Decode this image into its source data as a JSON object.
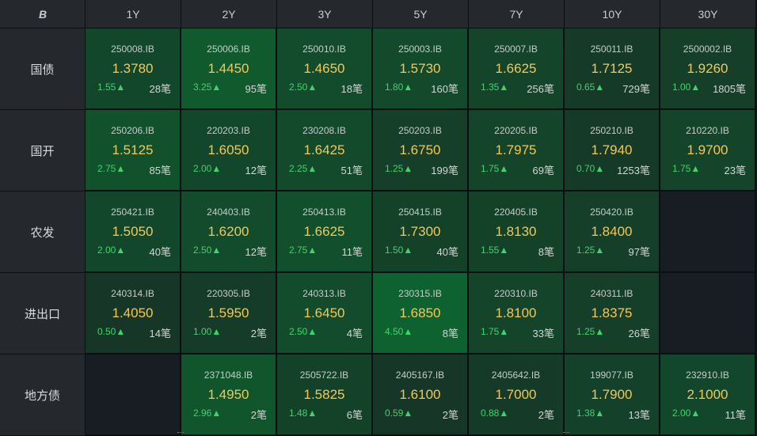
{
  "corner": {
    "icon": "logo-icon",
    "glyph": "B"
  },
  "tenors": [
    "1Y",
    "2Y",
    "3Y",
    "5Y",
    "7Y",
    "10Y",
    "30Y"
  ],
  "colors": {
    "rate": "#f2c85b",
    "change_up": "#3fd46a",
    "header_bg": "#25282d"
  },
  "rows": [
    {
      "label": "国债",
      "cells": [
        {
          "code": "250008.IB",
          "rate": "1.3780",
          "change": "1.55▲",
          "count": "28笔",
          "intensity": 0.5
        },
        {
          "code": "250006.IB",
          "rate": "1.4450",
          "change": "3.25▲",
          "count": "95笔",
          "intensity": 0.85
        },
        {
          "code": "250010.IB",
          "rate": "1.4650",
          "change": "2.50▲",
          "count": "18笔",
          "intensity": 0.6
        },
        {
          "code": "250003.IB",
          "rate": "1.5730",
          "change": "1.80▲",
          "count": "160笔",
          "intensity": 0.55
        },
        {
          "code": "250007.IB",
          "rate": "1.6625",
          "change": "1.35▲",
          "count": "256笔",
          "intensity": 0.45
        },
        {
          "code": "250011.IB",
          "rate": "1.7125",
          "change": "0.65▲",
          "count": "729笔",
          "intensity": 0.25
        },
        {
          "code": "2500002.IB",
          "rate": "1.9260",
          "change": "1.00▲",
          "count": "1805笔",
          "intensity": 0.35
        }
      ]
    },
    {
      "label": "国开",
      "cells": [
        {
          "code": "250206.IB",
          "rate": "1.5125",
          "change": "2.75▲",
          "count": "85笔",
          "intensity": 0.7
        },
        {
          "code": "220203.IB",
          "rate": "1.6050",
          "change": "2.00▲",
          "count": "12笔",
          "intensity": 0.5
        },
        {
          "code": "230208.IB",
          "rate": "1.6425",
          "change": "2.25▲",
          "count": "51笔",
          "intensity": 0.55
        },
        {
          "code": "250203.IB",
          "rate": "1.6750",
          "change": "1.25▲",
          "count": "199笔",
          "intensity": 0.35
        },
        {
          "code": "220205.IB",
          "rate": "1.7975",
          "change": "1.75▲",
          "count": "69笔",
          "intensity": 0.45
        },
        {
          "code": "250210.IB",
          "rate": "1.7940",
          "change": "0.70▲",
          "count": "1253笔",
          "intensity": 0.25
        },
        {
          "code": "210220.IB",
          "rate": "1.9700",
          "change": "1.75▲",
          "count": "23笔",
          "intensity": 0.45
        }
      ]
    },
    {
      "label": "农发",
      "cells": [
        {
          "code": "250421.IB",
          "rate": "1.5050",
          "change": "2.00▲",
          "count": "40笔",
          "intensity": 0.5
        },
        {
          "code": "240403.IB",
          "rate": "1.6200",
          "change": "2.50▲",
          "count": "12笔",
          "intensity": 0.6
        },
        {
          "code": "250413.IB",
          "rate": "1.6625",
          "change": "2.75▲",
          "count": "11笔",
          "intensity": 0.65
        },
        {
          "code": "250415.IB",
          "rate": "1.7300",
          "change": "1.50▲",
          "count": "40笔",
          "intensity": 0.4
        },
        {
          "code": "220405.IB",
          "rate": "1.8130",
          "change": "1.55▲",
          "count": "8笔",
          "intensity": 0.4
        },
        {
          "code": "250420.IB",
          "rate": "1.8400",
          "change": "1.25▲",
          "count": "97笔",
          "intensity": 0.35
        },
        null
      ]
    },
    {
      "label": "进出口",
      "cells": [
        {
          "code": "240314.IB",
          "rate": "1.4050",
          "change": "0.50▲",
          "count": "14笔",
          "intensity": 0.2
        },
        {
          "code": "220305.IB",
          "rate": "1.5950",
          "change": "1.00▲",
          "count": "2笔",
          "intensity": 0.3
        },
        {
          "code": "240313.IB",
          "rate": "1.6450",
          "change": "2.50▲",
          "count": "4笔",
          "intensity": 0.6
        },
        {
          "code": "230315.IB",
          "rate": "1.6850",
          "change": "4.50▲",
          "count": "8笔",
          "intensity": 1.0
        },
        {
          "code": "220310.IB",
          "rate": "1.8100",
          "change": "1.75▲",
          "count": "33笔",
          "intensity": 0.45
        },
        {
          "code": "240311.IB",
          "rate": "1.8375",
          "change": "1.25▲",
          "count": "26笔",
          "intensity": 0.35
        },
        null
      ]
    },
    {
      "label": "地方债",
      "cells": [
        null,
        {
          "code": "2371048.IB",
          "rate": "1.4950",
          "change": "2.96▲",
          "count": "2笔",
          "intensity": 0.75
        },
        {
          "code": "2505722.IB",
          "rate": "1.5825",
          "change": "1.48▲",
          "count": "6笔",
          "intensity": 0.4
        },
        {
          "code": "2405167.IB",
          "rate": "1.6100",
          "change": "0.59▲",
          "count": "2笔",
          "intensity": 0.2
        },
        {
          "code": "2405642.IB",
          "rate": "1.7000",
          "change": "0.88▲",
          "count": "2笔",
          "intensity": 0.28
        },
        {
          "code": "199077.IB",
          "rate": "1.7900",
          "change": "1.38▲",
          "count": "13笔",
          "intensity": 0.38
        },
        {
          "code": "232910.IB",
          "rate": "2.1000",
          "change": "2.00▲",
          "count": "11笔",
          "intensity": 0.5
        }
      ]
    }
  ]
}
